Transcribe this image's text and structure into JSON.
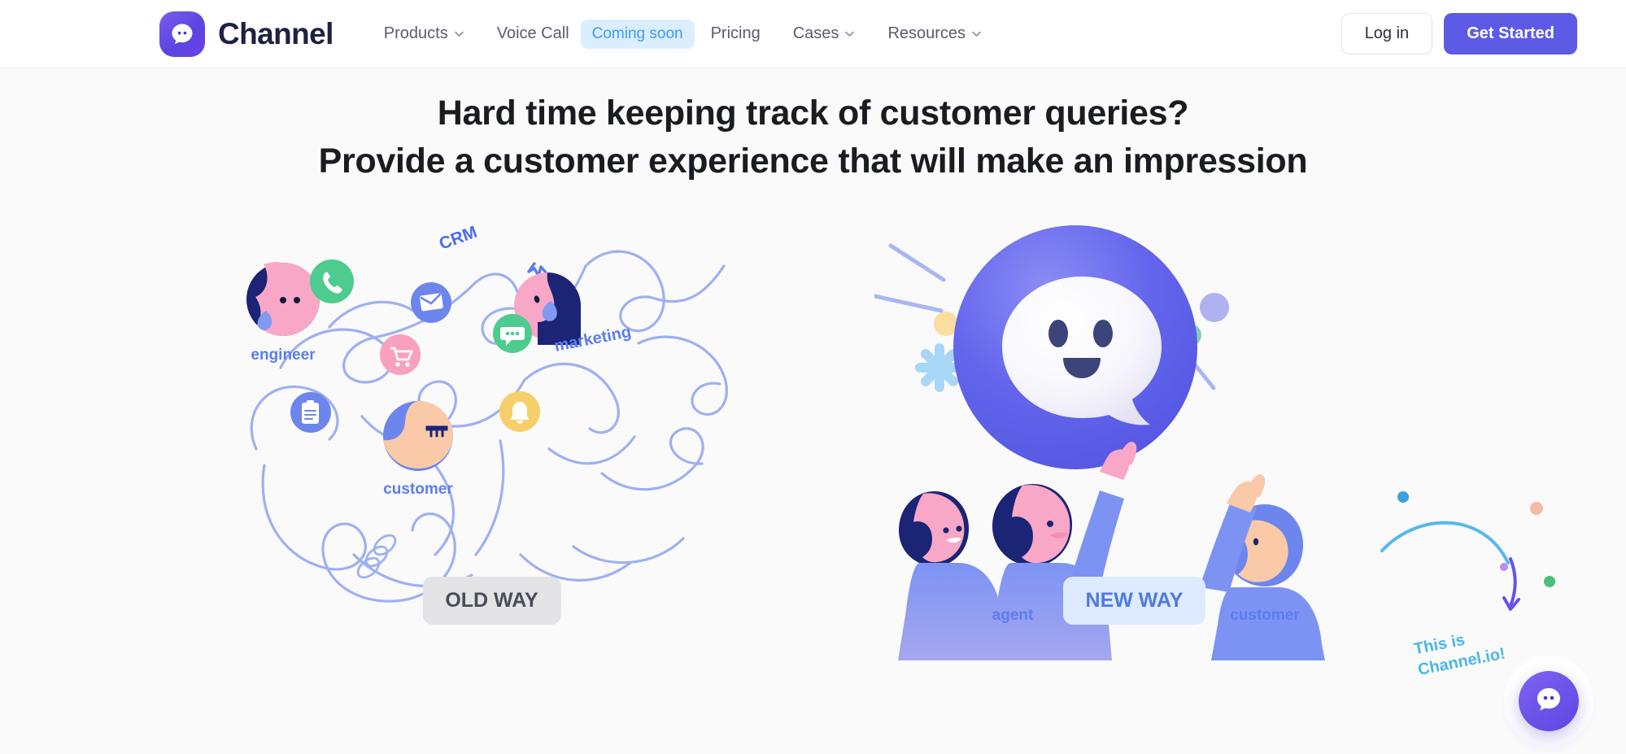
{
  "nav": {
    "brand": {
      "name": "Channel",
      "logo_icon": "chat-bubble-logo-icon",
      "logo_color": "#5d45e2"
    },
    "links": [
      {
        "label": "Products",
        "has_caret": true,
        "icon": "chevron-down-icon"
      },
      {
        "label": "Voice Call",
        "has_caret": false
      },
      {
        "label": "Pricing",
        "has_caret": false
      },
      {
        "label": "Cases",
        "has_caret": true,
        "icon": "chevron-down-icon"
      },
      {
        "label": "Resources",
        "has_caret": true,
        "icon": "chevron-down-icon"
      }
    ],
    "coming_soon_badge": "Coming soon",
    "login_label": "Log in",
    "get_started_label": "Get Started",
    "accent_color": "#5d5ae6",
    "badge_bg": "#dbeeff",
    "badge_text_color": "#3d9bf5"
  },
  "hero": {
    "headline_line1": "Hard time keeping track of customer queries?",
    "headline_line2": "Provide a customer experience that will make an impression",
    "old_panel": {
      "pill_label": "OLD WAY",
      "pill_bg": "#e4e4e7",
      "pill_text_color": "#4a4c57",
      "captions": [
        {
          "label": "engineer"
        },
        {
          "label": "CRM"
        },
        {
          "label": "marketing"
        },
        {
          "label": "customer"
        }
      ],
      "icons": [
        {
          "name": "phone-icon",
          "color": "#4ecb8e"
        },
        {
          "name": "envelope-icon",
          "color": "#6d86ed"
        },
        {
          "name": "shopping-cart-icon",
          "color": "#f9a0bf"
        },
        {
          "name": "chat-dots-icon",
          "color": "#4ecb8e"
        },
        {
          "name": "document-icon",
          "color": "#6d86ed"
        },
        {
          "name": "bell-icon",
          "color": "#f6cf6a"
        }
      ],
      "caption_color": "#5b7cf0"
    },
    "new_panel": {
      "pill_label": "NEW WAY",
      "pill_bg": "#ddeaff",
      "pill_text_color": "#4f7ae0",
      "captions": [
        {
          "label": "agent"
        },
        {
          "label": "customer"
        }
      ],
      "bubble_color": "#5f62ea",
      "caption_color": "#5b7cf0"
    }
  },
  "chat_widget": {
    "note": "This is\nChannel.io!",
    "note_color": "#49b6e8",
    "icon": "chat-launcher-icon",
    "color": "#6a50ec"
  }
}
